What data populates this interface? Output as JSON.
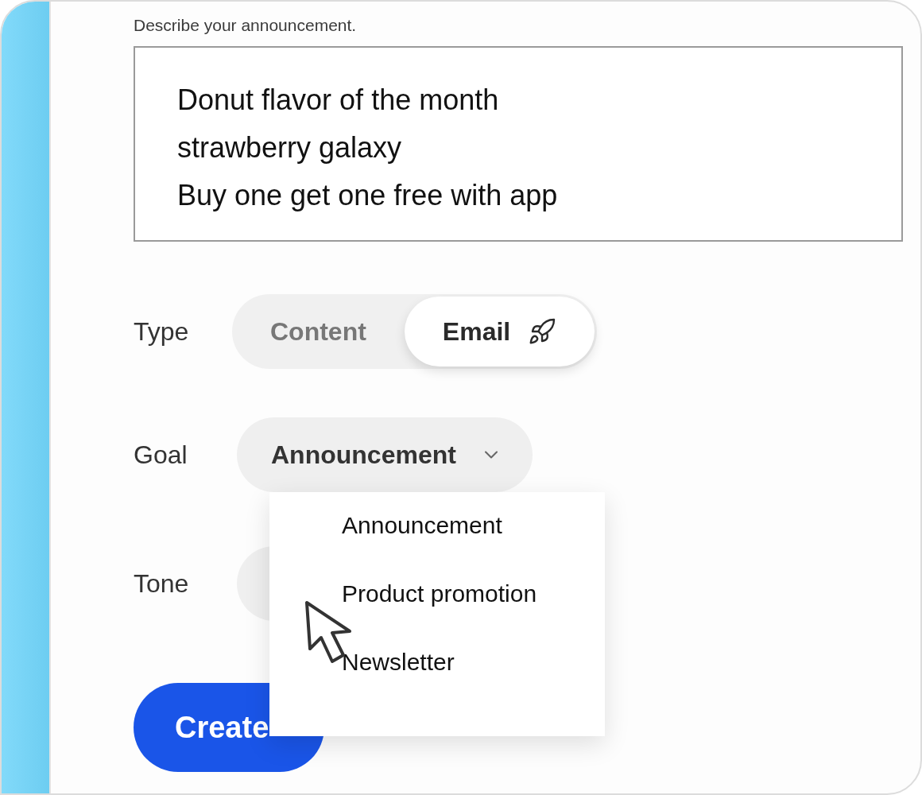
{
  "prompt": {
    "label": "Describe your announcement.",
    "lines": [
      "Donut flavor of the month",
      "strawberry galaxy",
      "Buy one get one free with app"
    ]
  },
  "type": {
    "label": "Type",
    "options": [
      {
        "label": "Content",
        "selected": false
      },
      {
        "label": "Email",
        "selected": true
      }
    ]
  },
  "goal": {
    "label": "Goal",
    "value": "Announcement",
    "expanded": true,
    "options": [
      "Announcement",
      "Product promotion",
      "Newsletter"
    ]
  },
  "tone": {
    "label": "Tone"
  },
  "create_button": "Create"
}
